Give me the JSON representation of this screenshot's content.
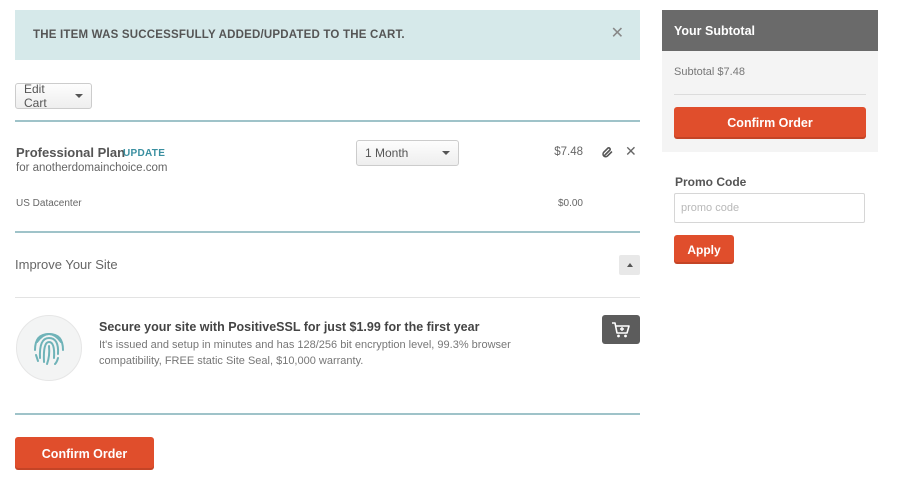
{
  "alert": {
    "message": "THE ITEM WAS SUCCESSFULLY ADDED/UPDATED TO THE CART.",
    "close_icon": "close-icon"
  },
  "cart": {
    "edit_label": "Edit Cart",
    "item": {
      "name": "Professional Plan",
      "update_link": "UPDATE",
      "domain": "for anotherdomainchoice.com",
      "term": "1 Month",
      "price": "$7.48"
    },
    "datacenter": {
      "label": "US Datacenter",
      "price": "$0.00"
    }
  },
  "improve": {
    "title": "Improve Your Site",
    "offer": {
      "title": "Secure your site with PositiveSSL for just $1.99 for the first year",
      "description": "It's issued and setup in minutes and has 128/256 bit encryption level, 99.3% browser compatibility, FREE static Site Seal, $10,000 warranty."
    }
  },
  "confirm_label": "Confirm Order",
  "sidebar": {
    "title": "Your Subtotal",
    "subtotal": "Subtotal $7.48",
    "confirm_label": "Confirm Order"
  },
  "promo": {
    "label": "Promo Code",
    "placeholder": "promo code",
    "apply_label": "Apply"
  },
  "colors": {
    "alert_bg": "#d6e9ea",
    "accent_red": "#e04e2c",
    "sidebar_header": "#6a6a6a",
    "link_teal": "#3a8fa0"
  }
}
